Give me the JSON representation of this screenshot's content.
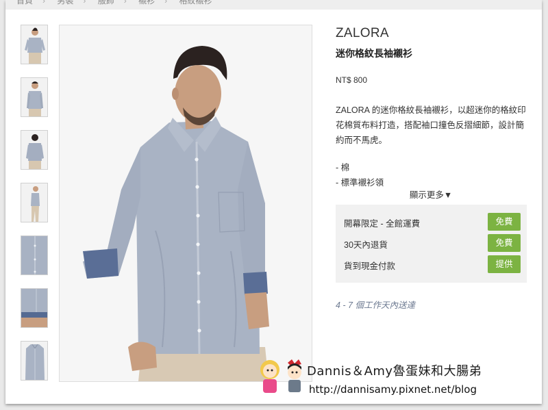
{
  "breadcrumb": [
    "首頁",
    "男裝",
    "服飾",
    "襯衫",
    "格紋襯衫"
  ],
  "product": {
    "brand": "ZALORA",
    "name": "迷你格紋長袖襯衫",
    "price": "NT$ 800",
    "description": "ZALORA 的迷你格紋長袖襯衫，以超迷你的格紋印花棉質布料打造，搭配袖口撞色反摺細節，設計簡約而不馬虎。",
    "bullets": [
      "- 棉",
      "- 標準襯衫領"
    ],
    "show_more": "顯示更多▼"
  },
  "services": [
    {
      "label": "開幕限定 - 全館運費",
      "badge": "免費"
    },
    {
      "label": "30天內退貨",
      "badge": "免費"
    },
    {
      "label": "貨到現金付款",
      "badge": "提供"
    }
  ],
  "delivery": "4 - 7 個工作天內送達",
  "watermark": {
    "title": "Dannis＆Amy魯蛋妹和大腸弟",
    "url": "http://dannisamy.pixnet.net/blog"
  },
  "colors": {
    "badge_green": "#7cb342",
    "shirt": "#a9b3c4",
    "delivery_text": "#6d7a91"
  },
  "thumbnails": [
    "front-view",
    "front-view-2",
    "back-view",
    "side-view",
    "fabric-detail",
    "cuff-detail",
    "flat-lay"
  ]
}
